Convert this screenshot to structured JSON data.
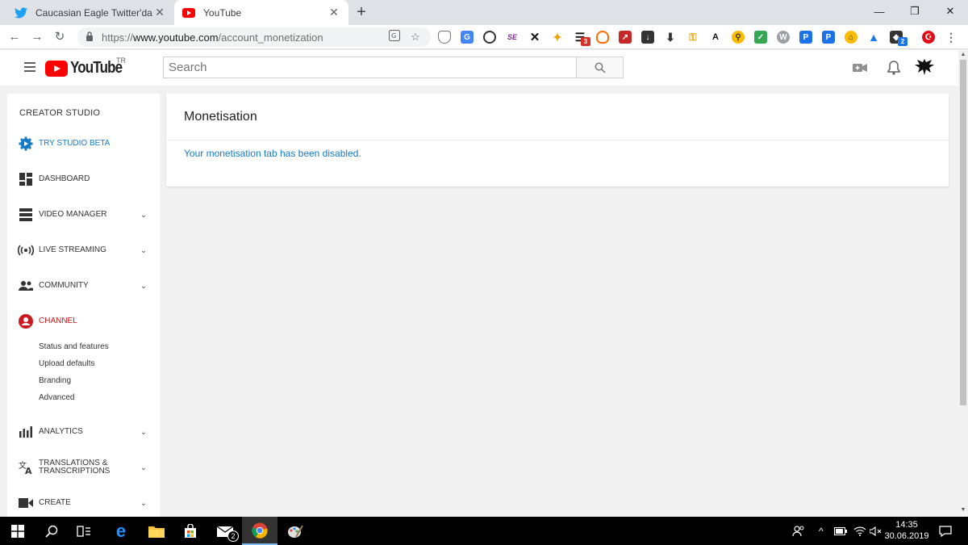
{
  "browser": {
    "tabs": [
      {
        "title": "Caucasian Eagle Twitter'da: \"@Te",
        "icon": "twitter-icon",
        "active": false
      },
      {
        "title": "YouTube",
        "icon": "youtube-icon",
        "active": true
      }
    ],
    "url_prefix": "https://",
    "url_host": "www.youtube.com",
    "url_path": "/account_monetization",
    "extension_badges": {
      "badge_3": "3",
      "badge_2": "2"
    }
  },
  "youtube": {
    "logo_text": "YouTube",
    "country": "TR",
    "search_placeholder": "Search"
  },
  "sidebar": {
    "title": "CREATOR STUDIO",
    "items": [
      {
        "label": "TRY STUDIO BETA",
        "icon": "gear-icon",
        "color": "#167ac6"
      },
      {
        "label": "DASHBOARD",
        "icon": "dashboard-icon"
      },
      {
        "label": "VIDEO MANAGER",
        "icon": "video-manager-icon"
      },
      {
        "label": "LIVE STREAMING",
        "icon": "live-streaming-icon"
      },
      {
        "label": "COMMUNITY",
        "icon": "community-icon"
      },
      {
        "label": "CHANNEL",
        "icon": "channel-icon",
        "color": "#cc181e"
      },
      {
        "label": "ANALYTICS",
        "icon": "analytics-icon"
      },
      {
        "label_line1": "TRANSLATIONS &",
        "label_line2": "TRANSCRIPTIONS",
        "icon": "translate-icon"
      },
      {
        "label": "CREATE",
        "icon": "create-icon"
      }
    ],
    "channel_subitems": [
      "Status and features",
      "Upload defaults",
      "Branding",
      "Advanced"
    ]
  },
  "main": {
    "title": "Monetisation",
    "message": "Your monetisation tab has been disabled."
  },
  "taskbar": {
    "time": "14:35",
    "date": "30.06.2019",
    "mail_badge": "2"
  },
  "colors": {
    "youtube_red": "#ff0000",
    "link_blue": "#167ac6",
    "channel_red": "#cc181e"
  }
}
